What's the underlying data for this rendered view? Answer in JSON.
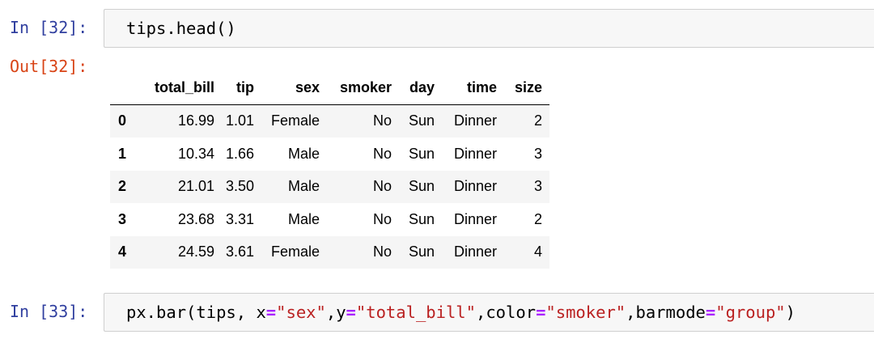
{
  "cells": [
    {
      "in_prompt": "In [32]:",
      "code": "tips.head()",
      "out_prompt": "Out[32]:"
    },
    {
      "in_prompt": "In [33]:",
      "code_tokens": [
        {
          "t": "px.bar(tips, x",
          "k": "plain"
        },
        {
          "t": "=",
          "k": "op"
        },
        {
          "t": "\"sex\"",
          "k": "str"
        },
        {
          "t": ",y",
          "k": "plain"
        },
        {
          "t": "=",
          "k": "op"
        },
        {
          "t": "\"total_bill\"",
          "k": "str"
        },
        {
          "t": ",color",
          "k": "plain"
        },
        {
          "t": "=",
          "k": "op"
        },
        {
          "t": "\"smoker\"",
          "k": "str"
        },
        {
          "t": ",barmode",
          "k": "plain"
        },
        {
          "t": "=",
          "k": "op"
        },
        {
          "t": "\"group\"",
          "k": "str"
        },
        {
          "t": ")",
          "k": "plain"
        }
      ]
    }
  ],
  "dataframe": {
    "columns": [
      "total_bill",
      "tip",
      "sex",
      "smoker",
      "day",
      "time",
      "size"
    ],
    "rows": [
      {
        "index": "0",
        "values": [
          "16.99",
          "1.01",
          "Female",
          "No",
          "Sun",
          "Dinner",
          "2"
        ]
      },
      {
        "index": "1",
        "values": [
          "10.34",
          "1.66",
          "Male",
          "No",
          "Sun",
          "Dinner",
          "3"
        ]
      },
      {
        "index": "2",
        "values": [
          "21.01",
          "3.50",
          "Male",
          "No",
          "Sun",
          "Dinner",
          "3"
        ]
      },
      {
        "index": "3",
        "values": [
          "23.68",
          "3.31",
          "Male",
          "No",
          "Sun",
          "Dinner",
          "2"
        ]
      },
      {
        "index": "4",
        "values": [
          "24.59",
          "3.61",
          "Female",
          "No",
          "Sun",
          "Dinner",
          "4"
        ]
      }
    ]
  },
  "colors": {
    "in_prompt": "#303f9f",
    "out_prompt": "#d84315",
    "string": "#ba2121",
    "operator": "#aa22ff",
    "cell_bg": "#f7f7f7",
    "cell_border": "#cfcfcf",
    "row_stripe": "#f5f5f5"
  }
}
